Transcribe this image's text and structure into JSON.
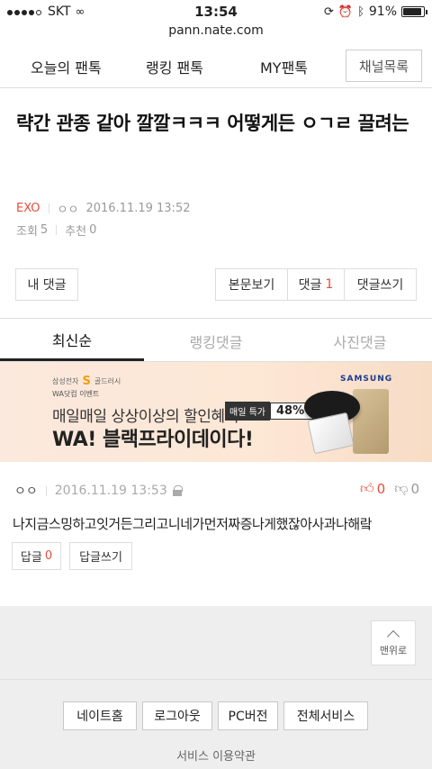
{
  "status": {
    "carrier": "SKT",
    "time": "13:54",
    "battery": "91%",
    "battery_level": 0.91
  },
  "url": "pann.nate.com",
  "nav": {
    "tabs": [
      "오늘의 팬톡",
      "랭킹 팬톡",
      "MY팬톡"
    ],
    "channel_button": "채널목록"
  },
  "post": {
    "title": "략간 관종 같아 깔깔ㅋㅋㅋ 어떻게든 ㅇㄱㄹ 끌려는",
    "channel": "EXO",
    "author": "ㅇㅇ",
    "date": "2016.11.19 13:52",
    "views_label": "조회",
    "views": "5",
    "recs_label": "추천",
    "recs": "0"
  },
  "buttons": {
    "my_comments": "내 댓글",
    "view_post": "본문보기",
    "comments": "댓글",
    "comments_count": "1",
    "write_comment": "댓글쓰기"
  },
  "comment_tabs": [
    "최신순",
    "랭킹댓글",
    "사진댓글"
  ],
  "banner": {
    "brand": "삼성전자",
    "brand_s": "S",
    "brand_sub": "골드러시",
    "event": "WA닷컴 이벤트",
    "line1": "매일매일 상상이상의 할인혜택",
    "badge_label": "매일 특가",
    "badge_value": "48%~",
    "line2": "WA! 블랙프라이데이다!",
    "samsung": "SAMSUNG"
  },
  "comment": {
    "author": "ㅇㅇ",
    "date": "2016.11.19 13:53",
    "up": "0",
    "down": "0",
    "text": "나지금스밍하고잇거든그리고니네가먼저짜증나게했잖아사과나해랔",
    "reply_label": "답글",
    "reply_count": "0",
    "reply_write": "답글쓰기"
  },
  "footer": {
    "to_top": "맨위로",
    "buttons": [
      "네이트홈",
      "로그아웃",
      "PC버전",
      "전체서비스"
    ],
    "terms": "서비스 이용약관"
  }
}
